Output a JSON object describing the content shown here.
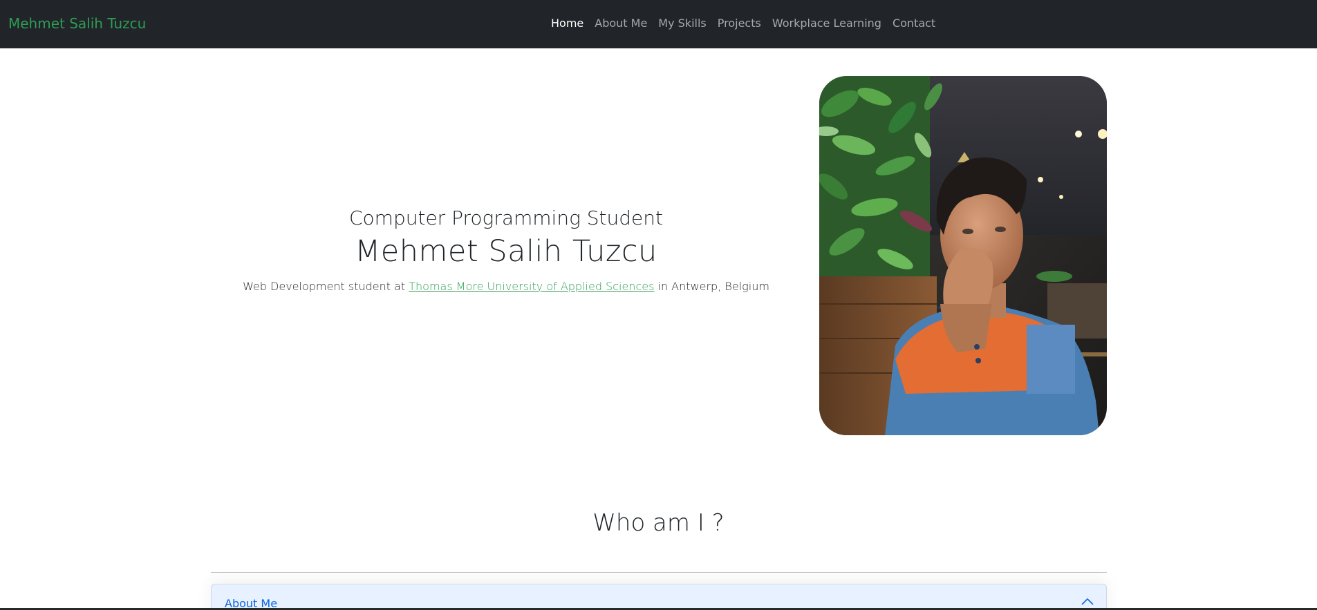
{
  "navbar": {
    "brand": "Mehmet Salih Tuzcu",
    "links": [
      {
        "label": "Home",
        "active": true
      },
      {
        "label": "About Me"
      },
      {
        "label": "My Skills"
      },
      {
        "label": "Projects"
      },
      {
        "label": "Workplace Learning"
      },
      {
        "label": "Contact"
      }
    ]
  },
  "hero": {
    "subtitle": "Computer Programming Student",
    "name": "Mehmet Salih Tuzcu",
    "desc_prefix": "Web Development student at ",
    "desc_link": "Thomas More University of Applied Sciences",
    "desc_suffix": " in Antwerp, Belgium"
  },
  "section": {
    "title": "Who am I ?"
  },
  "accordion": {
    "label": "About Me",
    "icon": "chevron-up-icon"
  },
  "colors": {
    "navbar_bg": "#212529",
    "brand": "#2e9d53",
    "link": "#2e9d53",
    "accordion_bg": "#e7f1ff",
    "accordion_text": "#0c63e4"
  }
}
